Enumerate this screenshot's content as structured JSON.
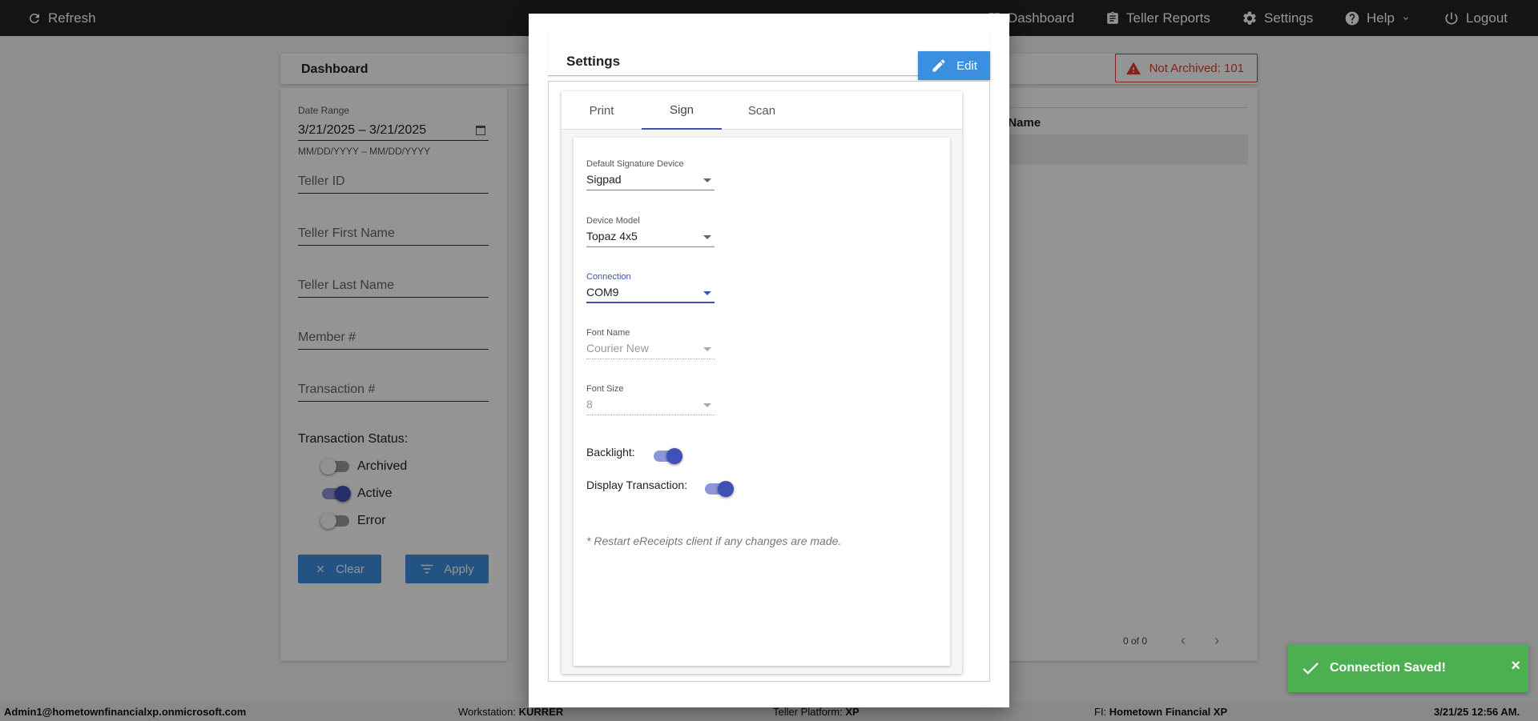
{
  "topbar": {
    "refresh_label": "Refresh",
    "dashboard_label": "Dashboard",
    "teller_reports_label": "Teller Reports",
    "settings_label": "Settings",
    "help_label": "Help",
    "logout_label": "Logout"
  },
  "page": {
    "title": "Dashboard",
    "not_archived_label": "Not Archived: 101"
  },
  "filters": {
    "date_range_label": "Date Range",
    "date_range_value": "3/21/2025 – 3/21/2025",
    "date_format_hint": "MM/DD/YYYY – MM/DD/YYYY",
    "teller_id_placeholder": "Teller ID",
    "teller_first_name_placeholder": "Teller First Name",
    "teller_last_name_placeholder": "Teller Last Name",
    "member_placeholder": "Member #",
    "transaction_placeholder": "Transaction #",
    "transaction_status_label": "Transaction Status:",
    "statuses": [
      {
        "label": "Archived",
        "on": false
      },
      {
        "label": "Active",
        "on": true
      },
      {
        "label": "Error",
        "on": false
      }
    ],
    "clear_label": "Clear",
    "apply_label": "Apply"
  },
  "results": {
    "column_header": "er Name",
    "pager_text": "0 of 0"
  },
  "modal": {
    "title": "Settings",
    "edit_label": "Edit",
    "tabs": [
      {
        "label": "Print",
        "active": false
      },
      {
        "label": "Sign",
        "active": true
      },
      {
        "label": "Scan",
        "active": false
      }
    ],
    "fields": {
      "default_signature_device_label": "Default Signature Device",
      "default_signature_device_value": "Sigpad",
      "device_model_label": "Device Model",
      "device_model_value": "Topaz 4x5",
      "connection_label": "Connection",
      "connection_value": "COM9",
      "font_name_label": "Font Name",
      "font_name_value": "Courier New",
      "font_size_label": "Font Size",
      "font_size_value": "8"
    },
    "backlight_label": "Backlight:",
    "backlight_on": true,
    "display_transaction_label": "Display Transaction:",
    "display_transaction_on": true,
    "note": "* Restart eReceipts client if any changes are made."
  },
  "toast": {
    "message": "Connection Saved!",
    "close_label": "×"
  },
  "statusbar": {
    "user": "Admin1@hometownfinancialxp.onmicrosoft.com",
    "workstation_label": "Workstation:",
    "workstation_value": "KURRER",
    "platform_label": "Teller Platform:",
    "platform_value": "XP",
    "fi_label": "FI:",
    "fi_value": "Hometown Financial XP",
    "datetime": "3/21/25 12:56 AM."
  },
  "colors": {
    "topbar": "#242424",
    "primary_button": "#3b8fe0",
    "toggle_on": "#3f51b5",
    "alert_red": "#e53935",
    "toast_green": "#4caf50"
  }
}
